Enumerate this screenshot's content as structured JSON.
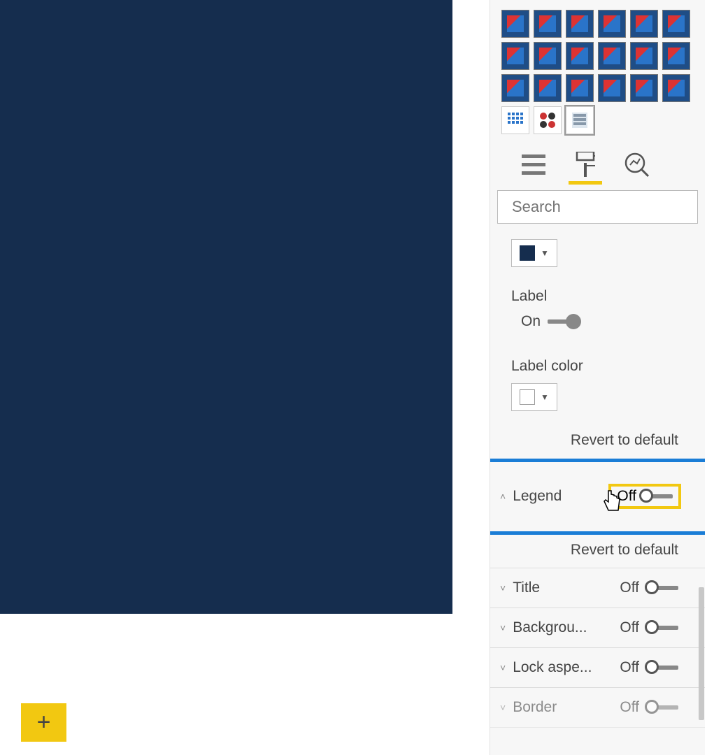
{
  "canvas": {
    "bg": "#152d4e"
  },
  "add_tab": {
    "label": "+"
  },
  "search": {
    "placeholder": "Search"
  },
  "color_picker_1": "#152d4e",
  "label_section": {
    "title": "Label",
    "toggle_state": "On"
  },
  "label_color_section": {
    "title": "Label color",
    "color": "#ffffff"
  },
  "revert1": "Revert to default",
  "legend": {
    "title": "Legend",
    "toggle_state": "Off"
  },
  "revert2": "Revert to default",
  "sections": [
    {
      "title": "Title",
      "state": "Off"
    },
    {
      "title": "Backgrou...",
      "state": "Off"
    },
    {
      "title": "Lock aspe...",
      "state": "Off"
    },
    {
      "title": "Border",
      "state": "Off"
    }
  ]
}
